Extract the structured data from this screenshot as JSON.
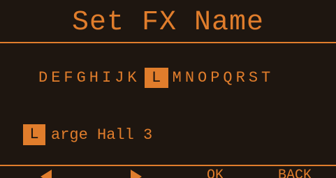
{
  "title": "Set FX Name",
  "char_selector": {
    "before": "DEFGHIJK",
    "selected": "L",
    "after": "MNOPQRST"
  },
  "name_field": {
    "cursor_char": "L",
    "rest": "arge Hall 3"
  },
  "softkeys": {
    "left_icon": "arrow-left-icon",
    "right_icon": "arrow-right-icon",
    "ok_label": "OK",
    "back_label": "BACK"
  },
  "colors": {
    "accent": "#e07d2c",
    "background": "#1e1610"
  }
}
